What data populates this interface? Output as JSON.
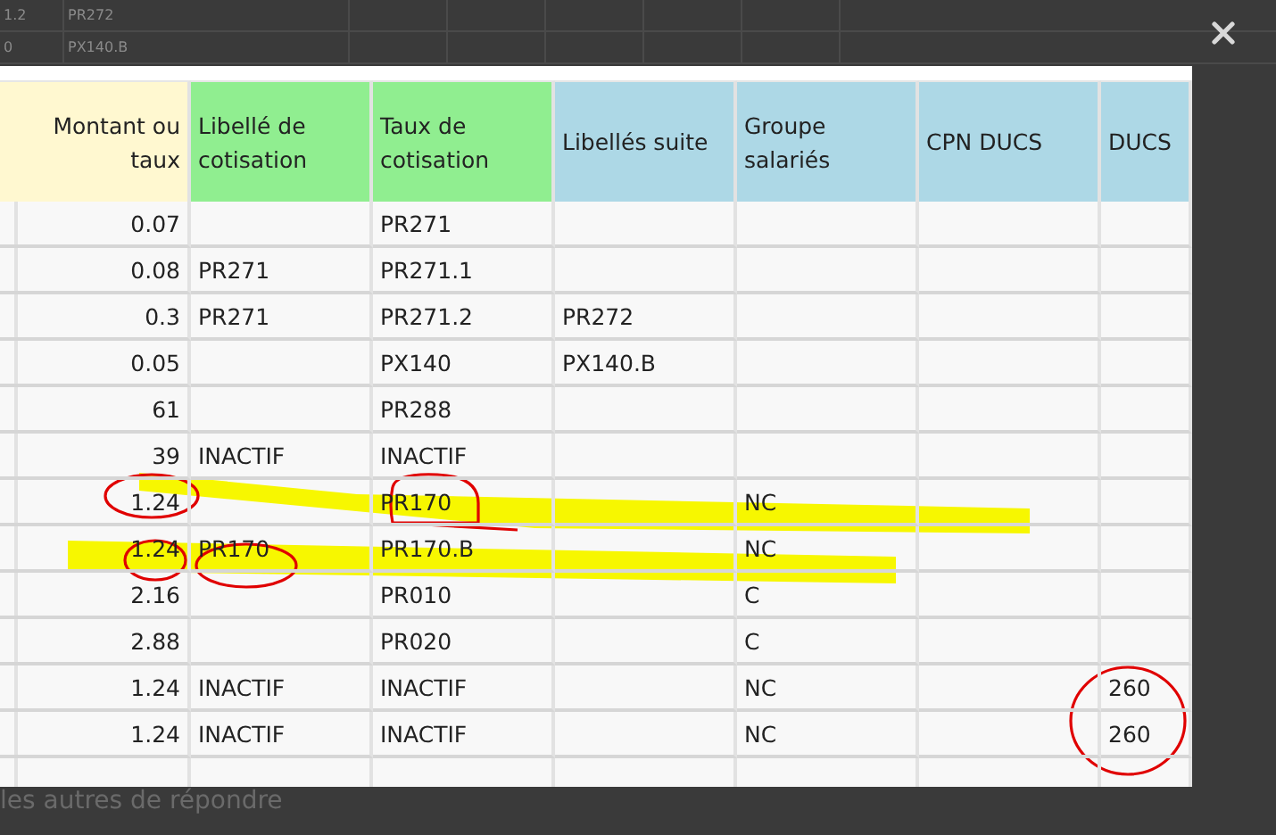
{
  "background_page": {
    "rows": [
      [
        "1.2",
        "PR272"
      ],
      [
        "0",
        "PX140.B"
      ]
    ],
    "text": "les autres de répondre"
  },
  "lightbox": {
    "columns": [
      {
        "label": "Montant ou taux",
        "color": "#fff8d0",
        "kind": "amount"
      },
      {
        "label": "Libellé de cotisation",
        "color": "#90ee90",
        "kind": "text"
      },
      {
        "label": "Taux de cotisation",
        "color": "#90ee90",
        "kind": "text"
      },
      {
        "label": "Libellés suite",
        "color": "#add8e6",
        "kind": "text"
      },
      {
        "label": "Groupe salariés",
        "color": "#add8e6",
        "kind": "text"
      },
      {
        "label": "CPN DUCS",
        "color": "#add8e6",
        "kind": "text"
      },
      {
        "label": "DUCS",
        "color": "#add8e6",
        "kind": "text"
      }
    ],
    "rows": [
      [
        "0.07",
        null,
        "PR271",
        null,
        null,
        null,
        null
      ],
      [
        "0.08",
        "PR271",
        "PR271.1",
        null,
        null,
        null,
        null
      ],
      [
        "0.3",
        "PR271",
        "PR271.2",
        "PR272",
        null,
        null,
        null
      ],
      [
        "0.05",
        null,
        "PX140",
        "PX140.B",
        null,
        null,
        null
      ],
      [
        "61",
        null,
        "PR288",
        null,
        null,
        null,
        null
      ],
      [
        "39",
        "INACTIF",
        "INACTIF",
        null,
        null,
        null,
        null
      ],
      [
        "1.24",
        null,
        "PR170",
        null,
        "NC",
        null,
        null
      ],
      [
        "1.24",
        "PR170",
        "PR170.B",
        null,
        "NC",
        null,
        null
      ],
      [
        "2.16",
        null,
        "PR010",
        null,
        "C",
        null,
        null
      ],
      [
        "2.88",
        null,
        "PR020",
        null,
        "C",
        null,
        null
      ],
      [
        "1.24",
        "INACTIF",
        "INACTIF",
        null,
        "NC",
        null,
        "260"
      ],
      [
        "1.24",
        "INACTIF",
        "INACTIF",
        null,
        "NC",
        null,
        "260"
      ]
    ]
  }
}
